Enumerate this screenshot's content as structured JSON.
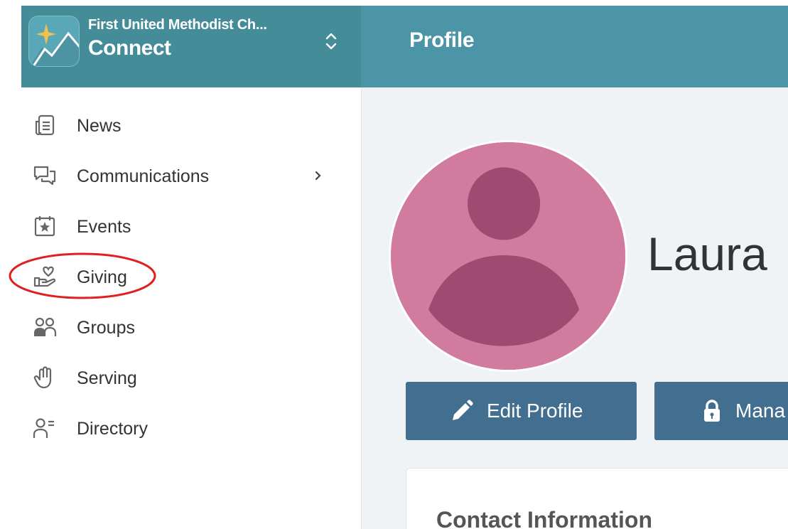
{
  "sidebar": {
    "org_name": "First United Methodist Ch...",
    "app_name": "Connect",
    "logo_icon": "sparkle-mountain-logo",
    "switcher_icon": "chevron-up-down-icon",
    "items": [
      {
        "label": "News",
        "icon": "news-icon"
      },
      {
        "label": "Communications",
        "icon": "chat-bubbles-icon",
        "has_submenu": true
      },
      {
        "label": "Events",
        "icon": "calendar-star-icon"
      },
      {
        "label": "Giving",
        "icon": "hand-heart-icon",
        "highlighted": true
      },
      {
        "label": "Groups",
        "icon": "people-icon"
      },
      {
        "label": "Serving",
        "icon": "raised-hand-icon"
      },
      {
        "label": "Directory",
        "icon": "person-list-icon"
      }
    ]
  },
  "header": {
    "title": "Profile"
  },
  "profile": {
    "name": "Laura",
    "avatar_icon": "default-avatar",
    "edit_button": "Edit Profile",
    "manage_button": "Mana",
    "contact_title": "Contact Information"
  },
  "colors": {
    "sidebar_header": "#458c99",
    "main_header": "#4b95a6",
    "button": "#426e8f",
    "avatar_bg": "#d17b9e",
    "avatar_fg": "#a04a71",
    "highlight_ring": "#e02020"
  }
}
